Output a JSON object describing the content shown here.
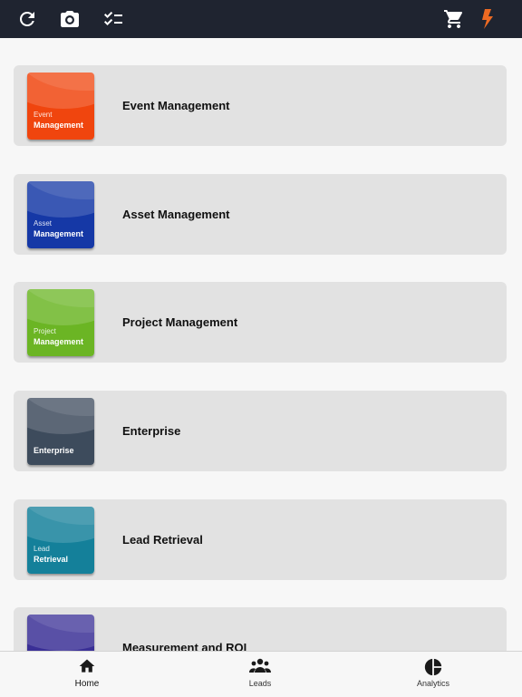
{
  "topbar": {
    "icons": [
      "refresh-icon",
      "camera-icon",
      "checklist-icon",
      "cart-icon",
      "bolt-icon"
    ],
    "colors": {
      "background": "#1f2430",
      "icon": "#ffffff",
      "accent": "#ee6a22"
    }
  },
  "apps": [
    {
      "title": "Event Management",
      "thumb_line1": "Event",
      "thumb_line2": "Management",
      "color": "#f0450e"
    },
    {
      "title": "Asset Management",
      "thumb_line1": "Asset",
      "thumb_line2": "Management",
      "color": "#1538a6"
    },
    {
      "title": "Project Management",
      "thumb_line1": "Project",
      "thumb_line2": "Management",
      "color": "#6bb524"
    },
    {
      "title": "Enterprise",
      "thumb_line1": "",
      "thumb_line2": "Enterprise",
      "color": "#3d4b5c"
    },
    {
      "title": "Lead Retrieval",
      "thumb_line1": "Lead",
      "thumb_line2": "Retrieval",
      "color": "#14809a"
    },
    {
      "title": "Measurement and ROI",
      "thumb_line1": "",
      "thumb_line2": "",
      "color": "#3a2f96"
    }
  ],
  "tabbar": {
    "tabs": [
      {
        "label": "Home",
        "icon": "home-icon"
      },
      {
        "label": "Leads",
        "icon": "people-icon"
      },
      {
        "label": "Analytics",
        "icon": "pie-chart-icon"
      }
    ]
  }
}
